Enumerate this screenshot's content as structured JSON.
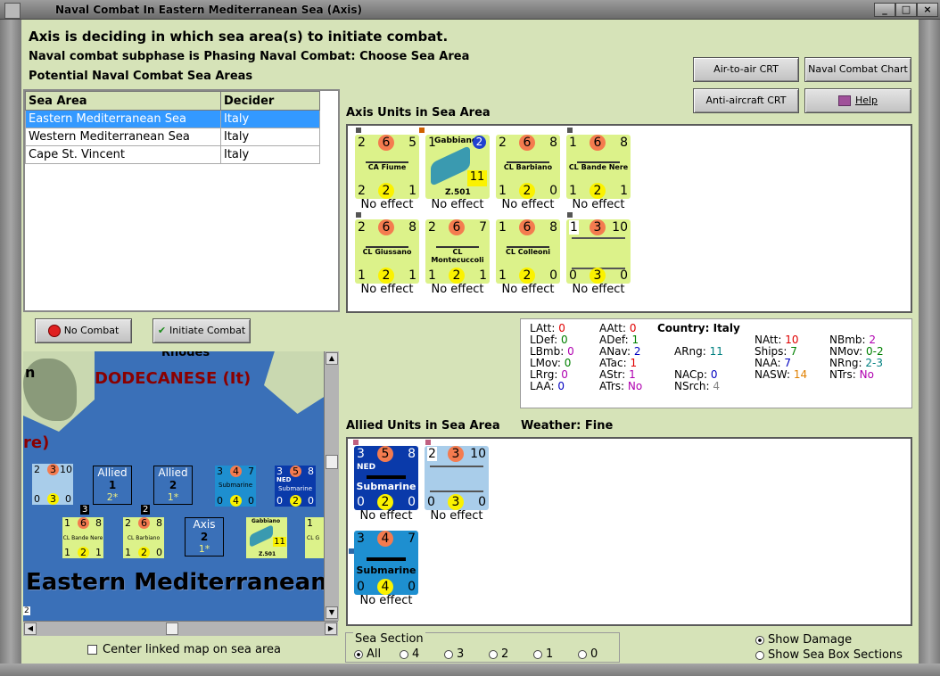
{
  "window": {
    "title": "Naval Combat In Eastern Mediterranean Sea (Axis)",
    "buttons": [
      "_",
      "□",
      "×"
    ]
  },
  "header": {
    "line1": "Axis is deciding in which sea area(s) to initiate combat.",
    "line2": "Naval combat subphase is Phasing Naval Combat: Choose Sea Area",
    "line3": "Potential Naval Combat Sea Areas"
  },
  "toolbar": {
    "air_crt": "Air-to-air CRT",
    "naval_chart": "Naval Combat Chart",
    "aa_crt": "Anti-aircraft CRT",
    "help": "Help"
  },
  "sea_table": {
    "headers": [
      "Sea Area",
      "Decider"
    ],
    "rows": [
      {
        "area": "Eastern Mediterranean Sea",
        "decider": "Italy"
      },
      {
        "area": "Western Mediterranean Sea",
        "decider": "Italy"
      },
      {
        "area": "Cape St. Vincent",
        "decider": "Italy"
      }
    ]
  },
  "combat_buttons": {
    "no_combat": "No Combat",
    "initiate": "Initiate Combat"
  },
  "axis_units": {
    "title": "Axis Units in Sea Area",
    "units": [
      {
        "tl": "2",
        "circ": "6",
        "tr": "5",
        "name": "CA Fiume",
        "bl": "2",
        "yc": "2",
        "br": "1",
        "status": "No effect"
      },
      {
        "tl": "1",
        "circ": "",
        "tr": "",
        "name": "Gabbiano",
        "sub": "Z.501",
        "extra": "11",
        "bl": "",
        "yc": "",
        "br": "",
        "status": "No effect"
      },
      {
        "tl": "2",
        "circ": "6",
        "tr": "8",
        "name": "CL Barbiano",
        "bl": "1",
        "yc": "2",
        "br": "0",
        "status": "No effect"
      },
      {
        "tl": "1",
        "circ": "6",
        "tr": "8",
        "name": "CL Bande Nere",
        "bl": "1",
        "yc": "2",
        "br": "1",
        "status": "No effect"
      },
      {
        "tl": "2",
        "circ": "6",
        "tr": "8",
        "name": "CL Giussano",
        "bl": "1",
        "yc": "2",
        "br": "1",
        "status": "No effect"
      },
      {
        "tl": "2",
        "circ": "6",
        "tr": "7",
        "name": "CL Montecuccoli",
        "bl": "1",
        "yc": "2",
        "br": "1",
        "status": "No effect"
      },
      {
        "tl": "1",
        "circ": "6",
        "tr": "8",
        "name": "CL Colleoni",
        "bl": "1",
        "yc": "2",
        "br": "0",
        "status": "No effect"
      },
      {
        "tl": "1",
        "circ": "3",
        "tr": "10",
        "name": "",
        "bl": "0",
        "yc": "3",
        "br": "0",
        "status": "No effect"
      }
    ]
  },
  "stats": {
    "country_label": "Country:",
    "country": "Italy",
    "items": [
      {
        "k": "LAtt:",
        "v": "0",
        "c": "#e00000"
      },
      {
        "k": "LDef:",
        "v": "0",
        "c": "#008000"
      },
      {
        "k": "LBmb:",
        "v": "0",
        "c": "#b000b0"
      },
      {
        "k": "LMov:",
        "v": "0",
        "c": "#008000"
      },
      {
        "k": "LRrg:",
        "v": "0",
        "c": "#b000b0"
      },
      {
        "k": "LAA:",
        "v": "0",
        "c": "#0000c0"
      },
      {
        "k": "AAtt:",
        "v": "0",
        "c": "#e00000"
      },
      {
        "k": "ADef:",
        "v": "1",
        "c": "#008000"
      },
      {
        "k": "ANav:",
        "v": "2",
        "c": "#0000c0"
      },
      {
        "k": "ATac:",
        "v": "1",
        "c": "#e00000"
      },
      {
        "k": "AStr:",
        "v": "1",
        "c": "#b000b0"
      },
      {
        "k": "ATrs:",
        "v": "No",
        "c": "#b000b0"
      },
      {
        "k": "ARng:",
        "v": "11",
        "c": "#008080"
      },
      {
        "k": "NACp:",
        "v": "0",
        "c": "#0000c0"
      },
      {
        "k": "NSrch:",
        "v": "4",
        "c": "#888888"
      },
      {
        "k": "NAtt:",
        "v": "10",
        "c": "#e00000"
      },
      {
        "k": "Ships:",
        "v": "7",
        "c": "#008000"
      },
      {
        "k": "NAA:",
        "v": "7",
        "c": "#0000c0"
      },
      {
        "k": "NASW:",
        "v": "14",
        "c": "#e08000"
      },
      {
        "k": "NBmb:",
        "v": "2",
        "c": "#b000b0"
      },
      {
        "k": "NMov:",
        "v": "0-2",
        "c": "#008000"
      },
      {
        "k": "NRng:",
        "v": "2-3",
        "c": "#008080"
      },
      {
        "k": "NTrs:",
        "v": "No",
        "c": "#b000b0"
      }
    ]
  },
  "allied": {
    "title": "Allied Units in Sea Area",
    "weather_label": "Weather:",
    "weather": "Fine",
    "units": [
      {
        "tl": "3",
        "circ": "5",
        "tr": "8",
        "nat": "NED",
        "name": "Submarine",
        "bl": "0",
        "yc": "2",
        "br": "0",
        "status": "No effect"
      },
      {
        "tl": "2",
        "circ": "3",
        "tr": "10",
        "nat": "",
        "name": "",
        "bl": "0",
        "yc": "3",
        "br": "0",
        "status": "No effect"
      },
      {
        "tl": "3",
        "circ": "4",
        "tr": "7",
        "nat": "",
        "name": "Submarine",
        "bl": "0",
        "yc": "4",
        "br": "0",
        "status": "No effect"
      }
    ]
  },
  "map": {
    "rhodes": "Rhodes",
    "dodecanese": "DODECANESE (It)",
    "frag_n": "n",
    "frag_re": "re)",
    "sea": "Eastern Mediterranean",
    "allied1": "Allied",
    "allied1_n": "1",
    "allied1_s": "2*",
    "allied2": "Allied",
    "allied2_n": "2",
    "allied2_s": "1*",
    "axis2": "Axis",
    "axis2_n": "2",
    "axis2_s": "1*",
    "stack3": "3",
    "stack2": "2",
    "corner": "2",
    "c1": {
      "tl": "2",
      "ci": "3",
      "tr": "10",
      "bl": "0",
      "yc": "3",
      "br": "0"
    },
    "c2": {
      "tl": "3",
      "ci": "4",
      "tr": "7",
      "nm": "Submarine",
      "bl": "0",
      "yc": "4",
      "br": "0"
    },
    "c3": {
      "tl": "3",
      "ci": "5",
      "tr": "8",
      "nat": "NED",
      "nm": "Submarine",
      "bl": "0",
      "yc": "2",
      "br": "0"
    },
    "c4": {
      "tl": "1",
      "ci": "6",
      "tr": "8",
      "nm": "CL Bande Nere",
      "bl": "1",
      "yc": "2",
      "br": "1"
    },
    "c5": {
      "tl": "2",
      "ci": "6",
      "tr": "8",
      "nm": "CL Barbiano",
      "bl": "1",
      "yc": "2",
      "br": "0"
    },
    "c6": {
      "nm": "Gabbiano",
      "sub": "Z.501",
      "ex": "11"
    },
    "c7": {
      "tl": "1",
      "nm": "CL G"
    }
  },
  "center_map": "Center linked map on sea area",
  "sea_section": {
    "title": "Sea Section",
    "options": [
      "All",
      "4",
      "3",
      "2",
      "1",
      "0"
    ]
  },
  "display_options": {
    "show_damage": "Show Damage",
    "show_sections": "Show Sea Box Sections"
  }
}
